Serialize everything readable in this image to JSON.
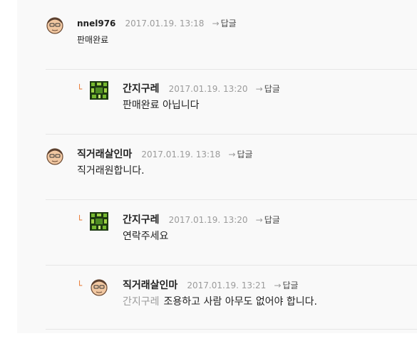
{
  "comments": [
    {
      "author": "nnel976",
      "date": "2017.01.19. 13:18",
      "reply_label": "답글",
      "text": "판매완료",
      "avatar_icon": "user-face-icon"
    },
    {
      "author": "간지구레",
      "date": "2017.01.19. 13:20",
      "reply_label": "답글",
      "text": "판매완료 아닙니다",
      "avatar_icon": "green-pixel-avatar-icon"
    },
    {
      "author": "직거래살인마",
      "date": "2017.01.19. 13:18",
      "reply_label": "답글",
      "text": "직거래원합니다.",
      "avatar_icon": "user-face-icon"
    },
    {
      "author": "간지구레",
      "date": "2017.01.19. 13:20",
      "reply_label": "답글",
      "text": "연락주세요",
      "avatar_icon": "green-pixel-avatar-icon"
    },
    {
      "author": "직거래살인마",
      "date": "2017.01.19. 13:21",
      "reply_label": "답글",
      "mention": "간지구레",
      "text": "조용하고 사람 아무도 없어야 합니다.",
      "avatar_icon": "user-face-icon"
    }
  ],
  "icons": {
    "reply_marker": "reply-indent-icon",
    "reply_arrow": "reply-arrow-icon"
  },
  "colors": {
    "reply_marker": "#e8742a",
    "date": "#9b9b9b",
    "text": "#222222"
  }
}
